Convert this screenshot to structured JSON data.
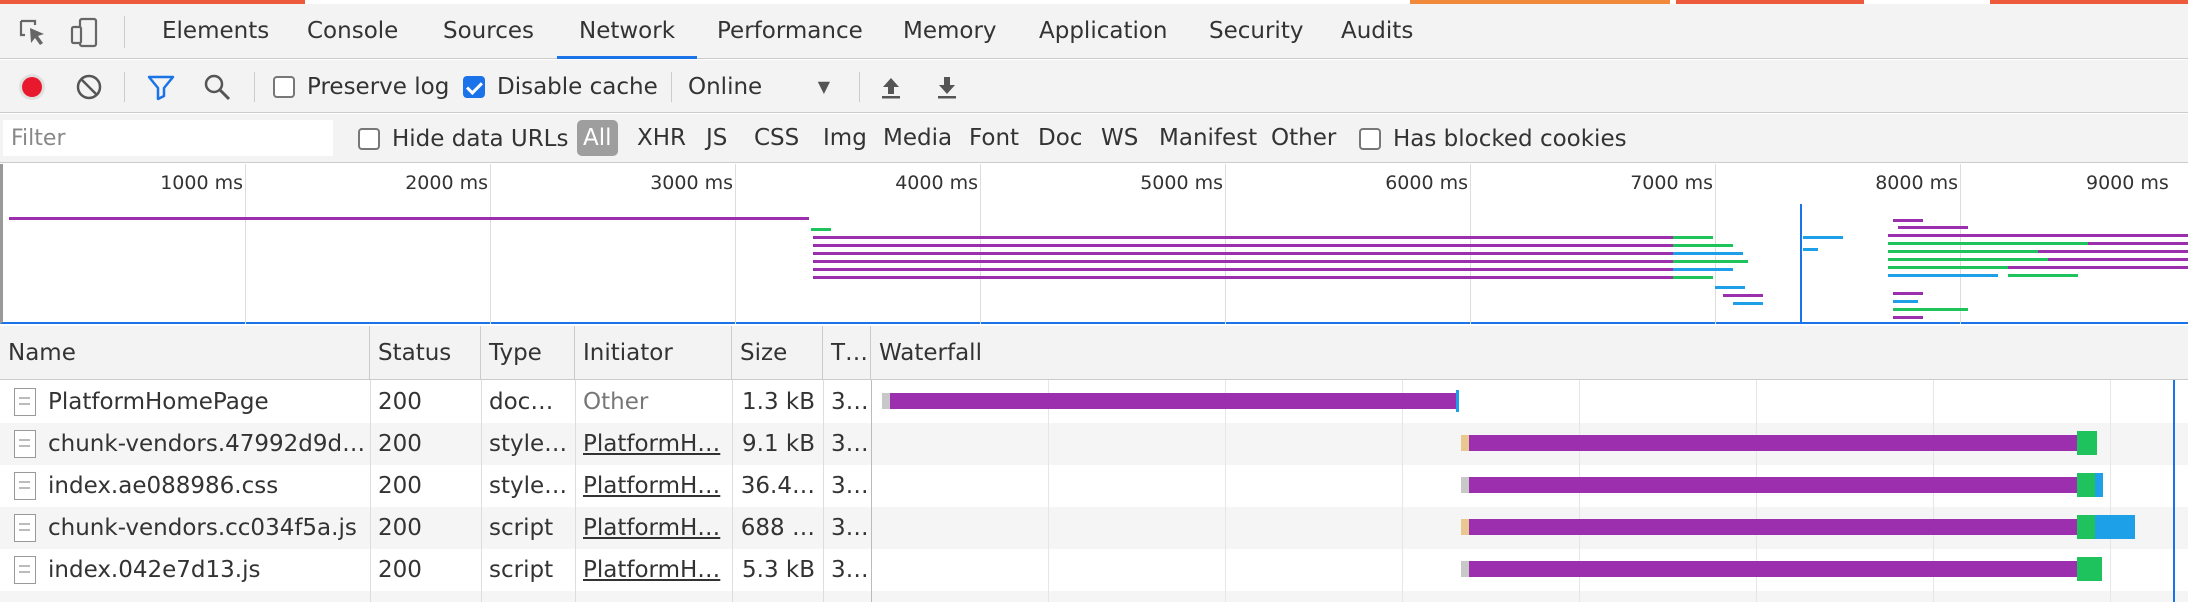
{
  "tabs": [
    "Elements",
    "Console",
    "Sources",
    "Network",
    "Performance",
    "Memory",
    "Application",
    "Security",
    "Audits"
  ],
  "active_tab": "Network",
  "toolbar": {
    "preserve_log": "Preserve log",
    "preserve_log_checked": false,
    "disable_cache": "Disable cache",
    "disable_cache_checked": true,
    "throttling": "Online"
  },
  "filterbar": {
    "placeholder": "Filter",
    "hide_data_urls": "Hide data URLs",
    "types": [
      "All",
      "XHR",
      "JS",
      "CSS",
      "Img",
      "Media",
      "Font",
      "Doc",
      "WS",
      "Manifest",
      "Other"
    ],
    "active_type": "All",
    "blocked_cookies": "Has blocked cookies"
  },
  "overview": {
    "ticks": [
      "1000 ms",
      "2000 ms",
      "3000 ms",
      "4000 ms",
      "5000 ms",
      "6000 ms",
      "7000 ms",
      "8000 ms",
      "9000 ms"
    ]
  },
  "table": {
    "columns": [
      "Name",
      "Status",
      "Type",
      "Initiator",
      "Size",
      "T…",
      "Waterfall"
    ],
    "rows": [
      {
        "name": "PlatformHomePage",
        "status": "200",
        "type": "doc…",
        "initiator": "Other",
        "size": "1.3 kB",
        "time": "3…"
      },
      {
        "name": "chunk-vendors.47992d9d.…",
        "status": "200",
        "type": "style…",
        "initiator": "PlatformH…",
        "size": "9.1 kB",
        "time": "3…"
      },
      {
        "name": "index.ae088986.css",
        "status": "200",
        "type": "style…",
        "initiator": "PlatformH…",
        "size": "36.4…",
        "time": "3…"
      },
      {
        "name": "chunk-vendors.cc034f5a.js",
        "status": "200",
        "type": "script",
        "initiator": "PlatformH…",
        "size": "688 …",
        "time": "3…"
      },
      {
        "name": "index.042e7d13.js",
        "status": "200",
        "type": "script",
        "initiator": "PlatformH…",
        "size": "5.3 kB",
        "time": "3…"
      }
    ]
  },
  "colors": {
    "accent": "#1a73e8",
    "record": "#e8192c",
    "waiting": "#9b2fae",
    "download": "#1ec35e",
    "content": "#1ea0e8",
    "stalled": "#c8c8c8"
  }
}
